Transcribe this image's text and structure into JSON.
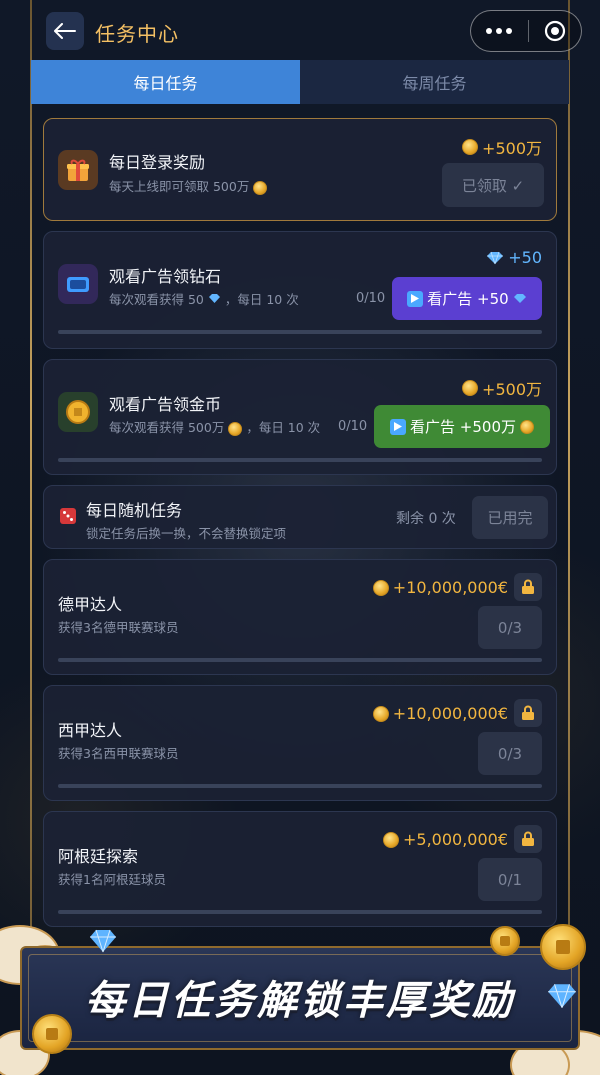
{
  "header": {
    "title": "任务中心"
  },
  "tabs": [
    {
      "label": "每日任务",
      "active": true
    },
    {
      "label": "每周任务",
      "active": false
    }
  ],
  "tasks": {
    "login": {
      "title": "每日登录奖励",
      "subtitle": "每天上线即可领取 500万",
      "reward": "+500万",
      "button": "已领取 ✓"
    },
    "ad_diamond": {
      "title": "观看广告领钻石",
      "subtitle_a": "每次观看获得 50",
      "subtitle_b": "，每日 10 次",
      "reward": "+50",
      "progress": "0/10",
      "button": "看广告 +50"
    },
    "ad_coin": {
      "title": "观看广告领金币",
      "subtitle_a": "每次观看获得 500万",
      "subtitle_b": "，每日 10 次",
      "reward": "+500万",
      "progress": "0/10",
      "button": "看广告 +500万"
    },
    "random": {
      "title": "每日随机任务",
      "subtitle": "锁定任务后换一换，不会替换锁定项",
      "remaining": "剩余 0 次",
      "button": "已用完"
    },
    "bundesliga": {
      "title": "德甲达人",
      "subtitle": "获得3名德甲联赛球员",
      "reward": "+10,000,000€",
      "progress": "0/3"
    },
    "laliga": {
      "title": "西甲达人",
      "subtitle": "获得3名西甲联赛球员",
      "reward": "+10,000,000€",
      "progress": "0/3"
    },
    "argentina": {
      "title": "阿根廷探索",
      "subtitle": "获得1名阿根廷球员",
      "reward": "+5,000,000€",
      "progress": "0/1"
    }
  },
  "banner": {
    "text": "每日任务解锁丰厚奖励"
  },
  "colors": {
    "accent_gold": "#f4c064",
    "tab_active": "#3e84d8",
    "ad_purple": "#5b3fd1",
    "ad_green": "#3f8a35",
    "diamond_blue": "#62b6ff"
  },
  "icons": [
    "back-arrow-icon",
    "more-dots-icon",
    "target-icon",
    "gift-icon",
    "tv-icon",
    "coin-icon",
    "dice-icon",
    "lock-icon",
    "play-icon",
    "diamond-icon",
    "check-icon"
  ]
}
